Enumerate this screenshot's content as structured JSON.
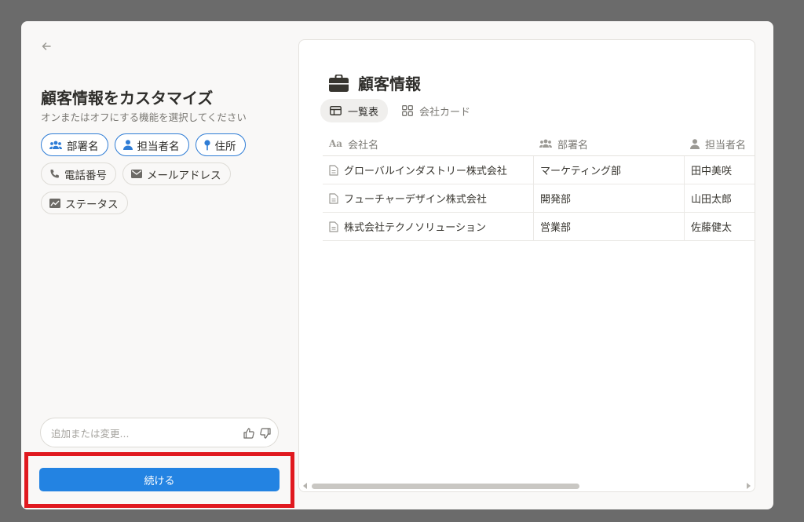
{
  "panel": {
    "title": "顧客情報をカスタマイズ",
    "subtitle": "オンまたはオフにする機能を選択してください",
    "chips": [
      {
        "label": "部署名",
        "icon": "group-icon",
        "active": true
      },
      {
        "label": "担当者名",
        "icon": "person-icon",
        "active": true
      },
      {
        "label": "住所",
        "icon": "pin-icon",
        "active": true
      },
      {
        "label": "電話番号",
        "icon": "phone-icon",
        "active": false
      },
      {
        "label": "メールアドレス",
        "icon": "mail-icon",
        "active": false
      },
      {
        "label": "ステータス",
        "icon": "status-icon",
        "active": false
      }
    ],
    "feedback_placeholder": "追加または変更...",
    "continue_label": "続ける"
  },
  "preview": {
    "title": "顧客情報",
    "views": [
      {
        "label": "一覧表",
        "icon": "table-icon",
        "active": true
      },
      {
        "label": "会社カード",
        "icon": "grid-icon",
        "active": false
      }
    ],
    "columns": [
      {
        "label": "会社名",
        "icon": "text-aa-icon"
      },
      {
        "label": "部署名",
        "icon": "group-icon"
      },
      {
        "label": "担当者名",
        "icon": "person-icon"
      }
    ],
    "rows": [
      [
        "グローバルインダストリー株式会社",
        "マーケティング部",
        "田中美咲"
      ],
      [
        "フューチャーデザイン株式会社",
        "開発部",
        "山田太郎"
      ],
      [
        "株式会社テクノソリューション",
        "営業部",
        "佐藤健太"
      ]
    ]
  },
  "colors": {
    "accent": "#2383e2",
    "chip_border_active": "#2f7dd6",
    "highlight": "#e0191f",
    "backdrop": "#6b6b6b"
  }
}
